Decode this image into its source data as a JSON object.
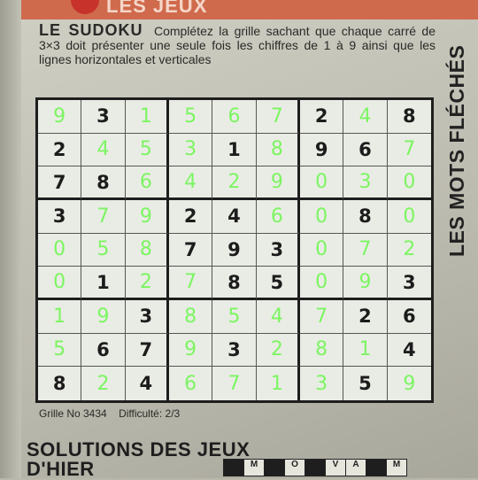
{
  "header": {
    "label": "LES JEUX"
  },
  "intro": {
    "title": "LE SUDOKU",
    "text": "Complétez la grille sachant que chaque carré de 3×3 doit présenter une seule fois les chiffres de 1 à 9 ainsi que les lignes horizontales et verticales"
  },
  "side_title": "LES MOTS FLÉCHÉS",
  "grid": {
    "rows": [
      [
        "9",
        "3",
        "1",
        "5",
        "6",
        "7",
        "2",
        "4",
        "8"
      ],
      [
        "2",
        "4",
        "5",
        "3",
        "1",
        "8",
        "9",
        "6",
        "7"
      ],
      [
        "7",
        "8",
        "6",
        "4",
        "2",
        "9",
        "0",
        "3",
        "0"
      ],
      [
        "3",
        "7",
        "9",
        "2",
        "4",
        "6",
        "0",
        "8",
        "0"
      ],
      [
        "0",
        "5",
        "8",
        "7",
        "9",
        "3",
        "0",
        "7",
        "2"
      ],
      [
        "0",
        "1",
        "2",
        "7",
        "8",
        "5",
        "0",
        "9",
        "3"
      ],
      [
        "1",
        "9",
        "3",
        "8",
        "5",
        "4",
        "7",
        "2",
        "6"
      ],
      [
        "5",
        "6",
        "7",
        "9",
        "3",
        "2",
        "8",
        "1",
        "4"
      ],
      [
        "8",
        "2",
        "4",
        "6",
        "7",
        "1",
        "3",
        "5",
        "9"
      ]
    ],
    "printed": [
      [
        0,
        1,
        0,
        0,
        0,
        0,
        1,
        0,
        1
      ],
      [
        1,
        0,
        0,
        0,
        1,
        0,
        1,
        1,
        0
      ],
      [
        1,
        1,
        0,
        0,
        0,
        0,
        0,
        0,
        0
      ],
      [
        1,
        0,
        0,
        1,
        1,
        0,
        0,
        1,
        0
      ],
      [
        0,
        0,
        0,
        1,
        1,
        1,
        0,
        0,
        0
      ],
      [
        0,
        1,
        0,
        0,
        1,
        1,
        0,
        0,
        1
      ],
      [
        0,
        0,
        1,
        0,
        0,
        0,
        0,
        1,
        1
      ],
      [
        0,
        1,
        1,
        0,
        1,
        0,
        0,
        0,
        1
      ],
      [
        1,
        0,
        1,
        0,
        0,
        0,
        0,
        1,
        0
      ]
    ],
    "solution_color": "#7cf562",
    "printed_color": "#1c1c1c"
  },
  "footer": {
    "grid_number": "Grille No 3434",
    "difficulty": "Difficulté: 2/3"
  },
  "solutions": {
    "line1": "SOLUTIONS  DES JEUX",
    "line2": "D'HIER"
  },
  "mini_grid": {
    "letters": [
      "",
      "M",
      "",
      "O",
      "",
      "V",
      "A",
      "",
      "M"
    ]
  }
}
